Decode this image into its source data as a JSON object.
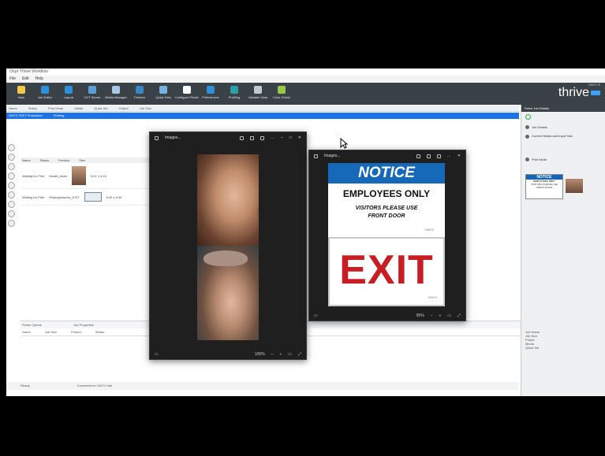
{
  "window": {
    "title": "Onyx Thrive Workflow"
  },
  "menu": [
    "File",
    "Edit",
    "Help"
  ],
  "ribbon": {
    "buttons": [
      {
        "label": "New",
        "color": "#f2c84b"
      },
      {
        "label": "Job Editor",
        "color": "#2e90d9"
      },
      {
        "label": "Layout",
        "color": "#2e90d9"
      },
      {
        "label": "CUT Server",
        "color": "#5aa0d8"
      },
      {
        "label": "Media Manager",
        "color": "#a8c8e8"
      },
      {
        "label": "Printers",
        "color": "#3a86c8"
      },
      {
        "label": "Quick Sets",
        "color": "#7ab0e0"
      },
      {
        "label": "Configure Printer",
        "color": "#ffffff"
      },
      {
        "label": "Preferences",
        "color": "#2e90d9"
      },
      {
        "label": "Profiling",
        "color": "#2aa0a8"
      },
      {
        "label": "Variable Data",
        "color": "#c0c8d0"
      },
      {
        "label": "Color Check",
        "color": "#9ac84a"
      }
    ]
  },
  "brand": {
    "small": "ONYX ®",
    "big": "thrive"
  },
  "grid": {
    "headers": [
      "Name",
      "Status",
      "Print Mode",
      "Media",
      "Quick Set",
      "Output",
      "Job Size"
    ],
    "selected_row": [
      "ONYX TEST Production",
      "Printing",
      "",
      "",
      "",
      "",
      ""
    ]
  },
  "jobs": {
    "headers": [
      "Name",
      "Status",
      "Preview",
      "Size"
    ],
    "rows": [
      {
        "name": "Model_faces",
        "status": "Waiting for Print",
        "size": "5.67 x 4.43"
      },
      {
        "name": "Employeesonly_EXIT",
        "status": "Waiting for Print",
        "size": "6.00 x 5.00"
      }
    ]
  },
  "bottom": {
    "tabs": [
      "Printer Queue",
      "Job Properties"
    ],
    "columns": [
      "Name",
      "Job Size",
      "Printed",
      "Status"
    ],
    "status_left": "Ready",
    "status_mid": "Connected to ONYX Hub"
  },
  "right_pane": {
    "title": "Thrive Job Details",
    "items": [
      "Job Details",
      "Current Media and Input Size",
      "Print Mode"
    ],
    "bottom_rows": [
      "Job Name",
      "Job Size",
      "Printer",
      "Media",
      "Quick Set"
    ]
  },
  "viewer1": {
    "title": "Images...",
    "zoom": "100%"
  },
  "viewer2": {
    "title": "Images...",
    "zoom": "95%",
    "notice_heading": "NOTICE",
    "line1": "EMPLOYEES ONLY",
    "line2": "VISITORS PLEASE USE",
    "line3": "FRONT DOOR",
    "exit": "EXIT",
    "brand_mark": "ONYX"
  }
}
